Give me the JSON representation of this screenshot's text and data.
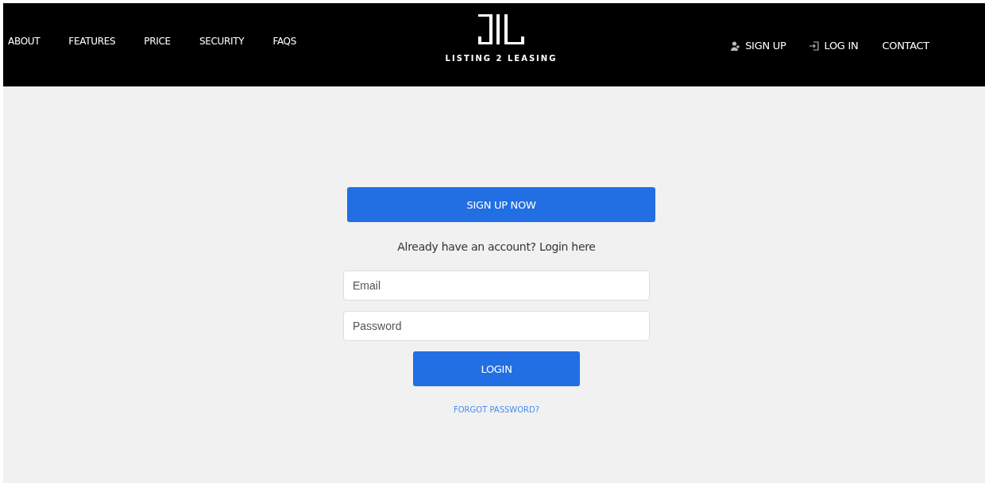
{
  "nav_left": [
    "ABOUT",
    "FEATURES",
    "PRICE",
    "SECURITY",
    "FAQS"
  ],
  "logo": {
    "name": "LISTING 2 LEASING"
  },
  "nav_right": [
    {
      "label": "SIGN UP",
      "kind": "signup"
    },
    {
      "label": "LOG IN",
      "kind": "login"
    },
    {
      "label": "CONTACT",
      "kind": "plain"
    }
  ],
  "signup_button": "SIGN UP NOW",
  "login_prompt": "Already have an account? Login here",
  "fields": [
    {
      "placeholder": "Email"
    },
    {
      "placeholder": "Password"
    }
  ],
  "login_button": "LOGIN",
  "forgot_link": "FORGOT PASSWORD?"
}
